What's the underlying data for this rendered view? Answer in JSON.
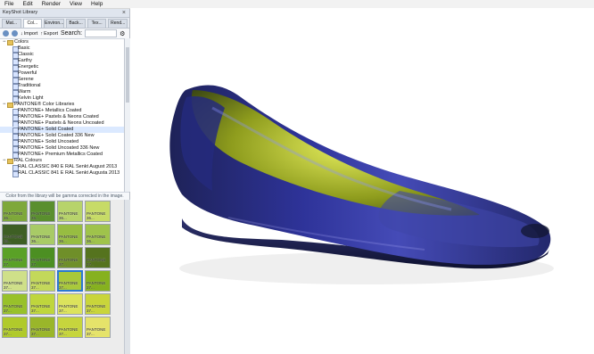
{
  "menu": [
    "File",
    "Edit",
    "Render",
    "View",
    "Help"
  ],
  "panel": {
    "title": "KeyShot Library",
    "close_icon": "close-icon",
    "tabs": [
      "Mat...",
      "Col...",
      "Environ...",
      "Back...",
      "Tex...",
      "Rend..."
    ],
    "active_tab": 1,
    "toolbar": {
      "import_label": "Import",
      "export_label": "Export",
      "search_label": "Search:"
    },
    "tree": [
      {
        "level": 0,
        "label": "Colors",
        "expanded": true
      },
      {
        "level": 1,
        "label": "Basic"
      },
      {
        "level": 1,
        "label": "Classic"
      },
      {
        "level": 1,
        "label": "Earthy"
      },
      {
        "level": 1,
        "label": "Energetic"
      },
      {
        "level": 1,
        "label": "Powerful"
      },
      {
        "level": 1,
        "label": "Serene"
      },
      {
        "level": 1,
        "label": "Traditional"
      },
      {
        "level": 1,
        "label": "Warm"
      },
      {
        "level": 1,
        "label": "Kelvin Light"
      },
      {
        "level": 0,
        "label": "PANTONE® Color Libraries",
        "expanded": true
      },
      {
        "level": 1,
        "label": "PANTONE+ Metallics Coated"
      },
      {
        "level": 1,
        "label": "PANTONE+ Pastels & Neons Coated"
      },
      {
        "level": 1,
        "label": "PANTONE+ Pastels & Neons Uncoated"
      },
      {
        "level": 1,
        "label": "PANTONE+ Solid Coated",
        "selected": true
      },
      {
        "level": 1,
        "label": "PANTONE+ Solid Coated 336 New"
      },
      {
        "level": 1,
        "label": "PANTONE+ Solid Uncoated"
      },
      {
        "level": 1,
        "label": "PANTONE+ Solid Uncoated 336 New"
      },
      {
        "level": 1,
        "label": "PANTONE+ Premium Metallics Coated"
      },
      {
        "level": 0,
        "label": "RAL Colours",
        "expanded": true
      },
      {
        "level": 1,
        "label": "RAL CLASSIC 840 E RAL Senkt August 2013"
      },
      {
        "level": 1,
        "label": "RAL CLASSIC 841 E RAL Senkt Augusta 2013"
      }
    ],
    "info_text": "Color from the library will be gamma corrected in the image.",
    "swatches": [
      {
        "label": "PANTONE 36...",
        "color": "#7ea83a"
      },
      {
        "label": "PANTONE 36...",
        "color": "#5a8f2e"
      },
      {
        "label": "PANTONE 36...",
        "color": "#b7d36b"
      },
      {
        "label": "PANTONE 36...",
        "color": "#c7db67"
      },
      {
        "label": "PANTONE 36...",
        "color": "#3e5f24"
      },
      {
        "label": "PANTONE 36...",
        "color": "#a8cb66"
      },
      {
        "label": "PANTONE 36...",
        "color": "#97bd41"
      },
      {
        "label": "PANTONE 36...",
        "color": "#9fc34b"
      },
      {
        "label": "PANTONE 37...",
        "color": "#5aa126"
      },
      {
        "label": "PANTONE 37...",
        "color": "#4c8f22"
      },
      {
        "label": "PANTONE 37...",
        "color": "#6f8f29"
      },
      {
        "label": "PANTONE 37...",
        "color": "#55731e"
      },
      {
        "label": "PANTONE 37...",
        "color": "#cfe089"
      },
      {
        "label": "PANTONE 37...",
        "color": "#c3d85a"
      },
      {
        "label": "PANTONE 37...",
        "color": "#a9c83b",
        "selected": true
      },
      {
        "label": "PANTONE 37...",
        "color": "#86b11f"
      },
      {
        "label": "PANTONE 37...",
        "color": "#98c12a"
      },
      {
        "label": "PANTONE 37...",
        "color": "#bfd63c"
      },
      {
        "label": "PANTONE 37...",
        "color": "#dce35c"
      },
      {
        "label": "PANTONE 37...",
        "color": "#c9d53a"
      },
      {
        "label": "PANTONE 37...",
        "color": "#b0ca2b"
      },
      {
        "label": "PANTONE 37...",
        "color": "#9ab62a"
      },
      {
        "label": "PANTONE 37...",
        "color": "#c6d53d"
      },
      {
        "label": "PANTONE 37...",
        "color": "#e5e36a"
      }
    ]
  },
  "render": {
    "object": "shoe-render",
    "shoe_color": "#3035a8",
    "lining_color": "#b9c62f"
  }
}
